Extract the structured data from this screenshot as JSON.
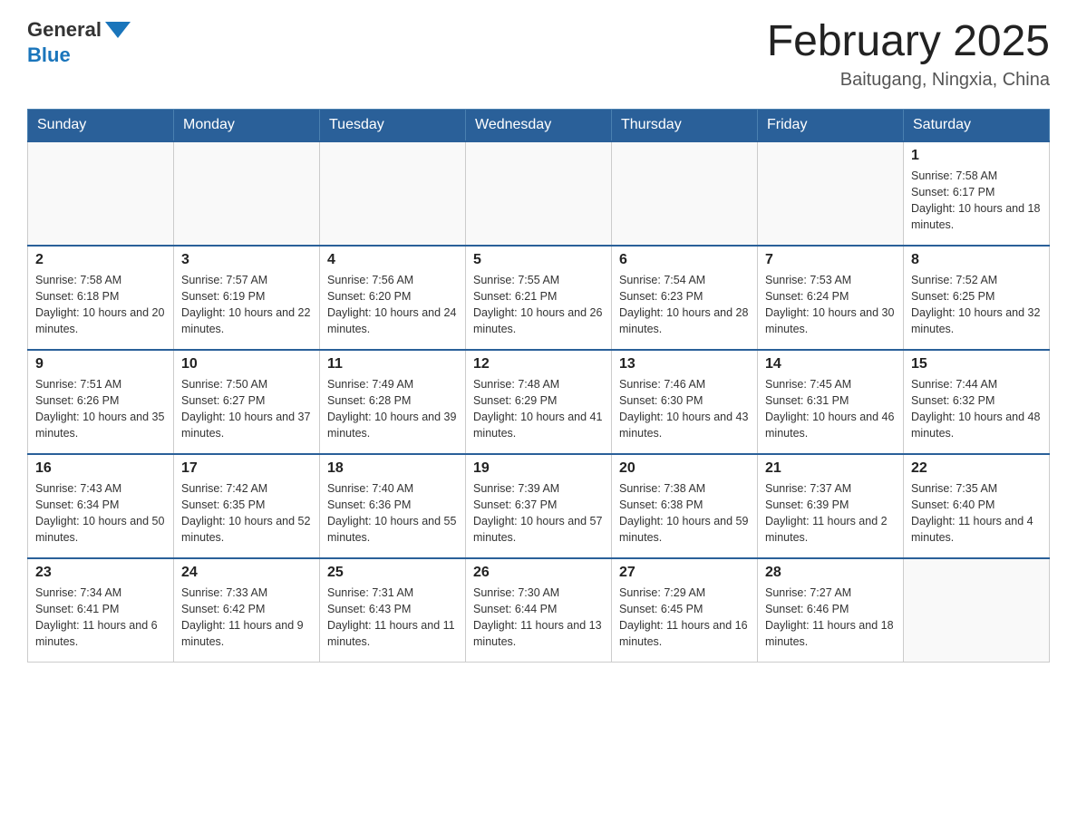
{
  "header": {
    "logo_general": "General",
    "logo_blue": "Blue",
    "month_title": "February 2025",
    "location": "Baitugang, Ningxia, China"
  },
  "days_of_week": [
    "Sunday",
    "Monday",
    "Tuesday",
    "Wednesday",
    "Thursday",
    "Friday",
    "Saturday"
  ],
  "weeks": [
    [
      {
        "day": "",
        "sunrise": "",
        "sunset": "",
        "daylight": ""
      },
      {
        "day": "",
        "sunrise": "",
        "sunset": "",
        "daylight": ""
      },
      {
        "day": "",
        "sunrise": "",
        "sunset": "",
        "daylight": ""
      },
      {
        "day": "",
        "sunrise": "",
        "sunset": "",
        "daylight": ""
      },
      {
        "day": "",
        "sunrise": "",
        "sunset": "",
        "daylight": ""
      },
      {
        "day": "",
        "sunrise": "",
        "sunset": "",
        "daylight": ""
      },
      {
        "day": "1",
        "sunrise": "Sunrise: 7:58 AM",
        "sunset": "Sunset: 6:17 PM",
        "daylight": "Daylight: 10 hours and 18 minutes."
      }
    ],
    [
      {
        "day": "2",
        "sunrise": "Sunrise: 7:58 AM",
        "sunset": "Sunset: 6:18 PM",
        "daylight": "Daylight: 10 hours and 20 minutes."
      },
      {
        "day": "3",
        "sunrise": "Sunrise: 7:57 AM",
        "sunset": "Sunset: 6:19 PM",
        "daylight": "Daylight: 10 hours and 22 minutes."
      },
      {
        "day": "4",
        "sunrise": "Sunrise: 7:56 AM",
        "sunset": "Sunset: 6:20 PM",
        "daylight": "Daylight: 10 hours and 24 minutes."
      },
      {
        "day": "5",
        "sunrise": "Sunrise: 7:55 AM",
        "sunset": "Sunset: 6:21 PM",
        "daylight": "Daylight: 10 hours and 26 minutes."
      },
      {
        "day": "6",
        "sunrise": "Sunrise: 7:54 AM",
        "sunset": "Sunset: 6:23 PM",
        "daylight": "Daylight: 10 hours and 28 minutes."
      },
      {
        "day": "7",
        "sunrise": "Sunrise: 7:53 AM",
        "sunset": "Sunset: 6:24 PM",
        "daylight": "Daylight: 10 hours and 30 minutes."
      },
      {
        "day": "8",
        "sunrise": "Sunrise: 7:52 AM",
        "sunset": "Sunset: 6:25 PM",
        "daylight": "Daylight: 10 hours and 32 minutes."
      }
    ],
    [
      {
        "day": "9",
        "sunrise": "Sunrise: 7:51 AM",
        "sunset": "Sunset: 6:26 PM",
        "daylight": "Daylight: 10 hours and 35 minutes."
      },
      {
        "day": "10",
        "sunrise": "Sunrise: 7:50 AM",
        "sunset": "Sunset: 6:27 PM",
        "daylight": "Daylight: 10 hours and 37 minutes."
      },
      {
        "day": "11",
        "sunrise": "Sunrise: 7:49 AM",
        "sunset": "Sunset: 6:28 PM",
        "daylight": "Daylight: 10 hours and 39 minutes."
      },
      {
        "day": "12",
        "sunrise": "Sunrise: 7:48 AM",
        "sunset": "Sunset: 6:29 PM",
        "daylight": "Daylight: 10 hours and 41 minutes."
      },
      {
        "day": "13",
        "sunrise": "Sunrise: 7:46 AM",
        "sunset": "Sunset: 6:30 PM",
        "daylight": "Daylight: 10 hours and 43 minutes."
      },
      {
        "day": "14",
        "sunrise": "Sunrise: 7:45 AM",
        "sunset": "Sunset: 6:31 PM",
        "daylight": "Daylight: 10 hours and 46 minutes."
      },
      {
        "day": "15",
        "sunrise": "Sunrise: 7:44 AM",
        "sunset": "Sunset: 6:32 PM",
        "daylight": "Daylight: 10 hours and 48 minutes."
      }
    ],
    [
      {
        "day": "16",
        "sunrise": "Sunrise: 7:43 AM",
        "sunset": "Sunset: 6:34 PM",
        "daylight": "Daylight: 10 hours and 50 minutes."
      },
      {
        "day": "17",
        "sunrise": "Sunrise: 7:42 AM",
        "sunset": "Sunset: 6:35 PM",
        "daylight": "Daylight: 10 hours and 52 minutes."
      },
      {
        "day": "18",
        "sunrise": "Sunrise: 7:40 AM",
        "sunset": "Sunset: 6:36 PM",
        "daylight": "Daylight: 10 hours and 55 minutes."
      },
      {
        "day": "19",
        "sunrise": "Sunrise: 7:39 AM",
        "sunset": "Sunset: 6:37 PM",
        "daylight": "Daylight: 10 hours and 57 minutes."
      },
      {
        "day": "20",
        "sunrise": "Sunrise: 7:38 AM",
        "sunset": "Sunset: 6:38 PM",
        "daylight": "Daylight: 10 hours and 59 minutes."
      },
      {
        "day": "21",
        "sunrise": "Sunrise: 7:37 AM",
        "sunset": "Sunset: 6:39 PM",
        "daylight": "Daylight: 11 hours and 2 minutes."
      },
      {
        "day": "22",
        "sunrise": "Sunrise: 7:35 AM",
        "sunset": "Sunset: 6:40 PM",
        "daylight": "Daylight: 11 hours and 4 minutes."
      }
    ],
    [
      {
        "day": "23",
        "sunrise": "Sunrise: 7:34 AM",
        "sunset": "Sunset: 6:41 PM",
        "daylight": "Daylight: 11 hours and 6 minutes."
      },
      {
        "day": "24",
        "sunrise": "Sunrise: 7:33 AM",
        "sunset": "Sunset: 6:42 PM",
        "daylight": "Daylight: 11 hours and 9 minutes."
      },
      {
        "day": "25",
        "sunrise": "Sunrise: 7:31 AM",
        "sunset": "Sunset: 6:43 PM",
        "daylight": "Daylight: 11 hours and 11 minutes."
      },
      {
        "day": "26",
        "sunrise": "Sunrise: 7:30 AM",
        "sunset": "Sunset: 6:44 PM",
        "daylight": "Daylight: 11 hours and 13 minutes."
      },
      {
        "day": "27",
        "sunrise": "Sunrise: 7:29 AM",
        "sunset": "Sunset: 6:45 PM",
        "daylight": "Daylight: 11 hours and 16 minutes."
      },
      {
        "day": "28",
        "sunrise": "Sunrise: 7:27 AM",
        "sunset": "Sunset: 6:46 PM",
        "daylight": "Daylight: 11 hours and 18 minutes."
      },
      {
        "day": "",
        "sunrise": "",
        "sunset": "",
        "daylight": ""
      }
    ]
  ]
}
